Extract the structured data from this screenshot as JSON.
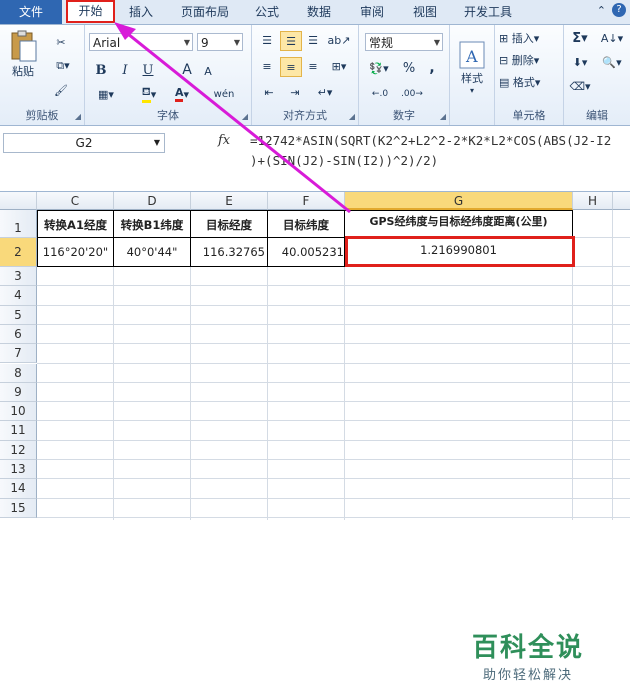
{
  "tabs": [
    "文件",
    "开始",
    "插入",
    "页面布局",
    "公式",
    "数据",
    "审阅",
    "视图",
    "开发工具"
  ],
  "ribbon": {
    "clipboard": {
      "paste_label": "粘贴",
      "group_label": "剪贴板"
    },
    "font": {
      "font_name": "Arial",
      "font_size": "9",
      "group_label": "字体",
      "bold": "B",
      "italic": "I",
      "underline": "U",
      "grow": "A",
      "shrink": "A",
      "wen": "wén"
    },
    "alignment": {
      "group_label": "对齐方式"
    },
    "number": {
      "format": "常规",
      "percent": "%",
      "comma": ",",
      "group_label": "数字"
    },
    "styles": {
      "label": "样式"
    },
    "cells": {
      "insert": "插入",
      "delete": "删除",
      "format": "格式",
      "group_label": "单元格"
    },
    "editing": {
      "sigma": "Σ",
      "group_label": "编辑"
    }
  },
  "formula_bar": {
    "name_box": "G2",
    "fx": "fx",
    "formula": "=12742*ASIN(SQRT(K2^2+L2^2-2*K2*L2*COS(ABS(J2-I2\n)+(SIN(J2)-SIN(I2))^2)/2)"
  },
  "sheet": {
    "columns": [
      "C",
      "D",
      "E",
      "F",
      "G",
      "H"
    ],
    "rows": [
      "1",
      "2",
      "3",
      "4",
      "5",
      "6",
      "7",
      "8",
      "9",
      "10",
      "11",
      "12",
      "13",
      "14",
      "15"
    ],
    "header_row": [
      "转换A1经度",
      "转换B1纬度",
      "目标经度",
      "目标纬度",
      "GPS经纬度与目标经纬度距离(公里)"
    ],
    "data_row": [
      "116°20'20\"",
      "40°0'44\"",
      "116.32765",
      "40.005231",
      "1.216990801"
    ]
  },
  "watermark": {
    "title": "百科全说",
    "subtitle": "助你轻松解决"
  },
  "colors": {
    "accent_red": "#e0201b",
    "arrow_magenta": "#d81bd8",
    "file_tab": "#2f67b2"
  }
}
